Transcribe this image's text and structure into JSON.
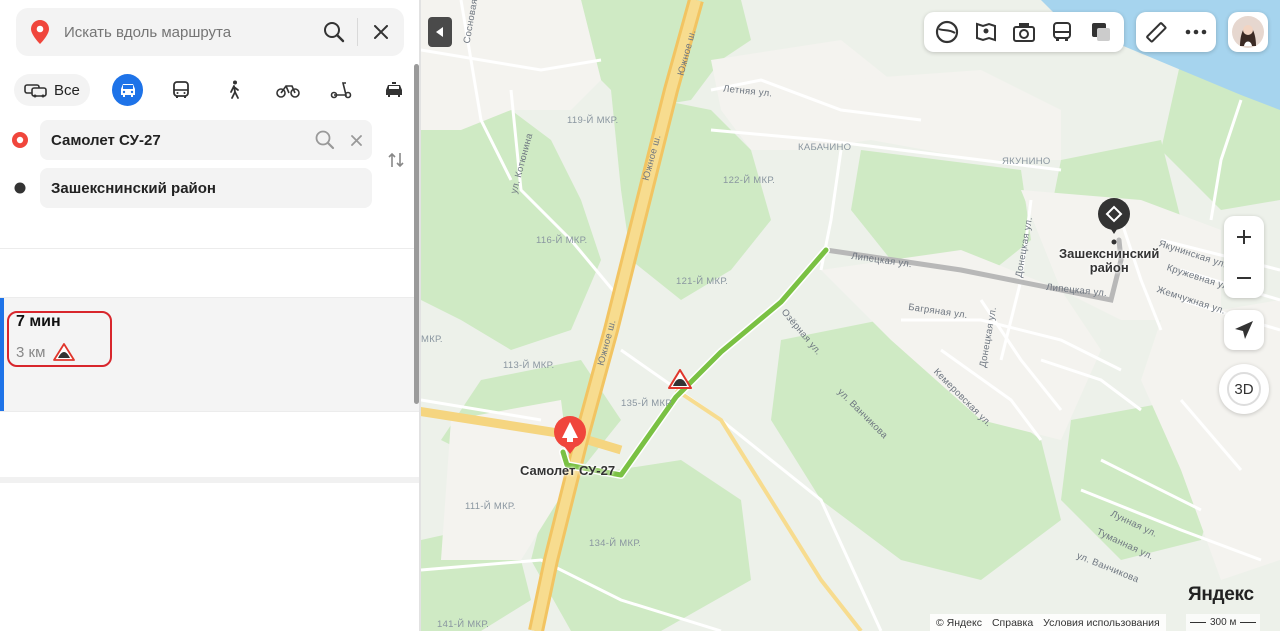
{
  "search": {
    "placeholder": "Искать вдоль маршрута"
  },
  "modes": {
    "all_label": "Все",
    "active": "car"
  },
  "route_points": [
    {
      "label": "Самолет СУ-27",
      "type": "start",
      "color": "#e8432b"
    },
    {
      "label": "Зашекснинский район",
      "type": "end",
      "color": "#333333"
    }
  ],
  "route": {
    "time": "7 мин",
    "distance": "3 км",
    "warning": "uneven-road"
  },
  "map": {
    "streets": {
      "yuzhnoe1": "Южное ш.",
      "yuzhnoe2": "Южное ш.",
      "yuzhnoe3": "Южное ш.",
      "sosnovaya": "Сосновая ул.",
      "kotyunina": "ул. Котюнина",
      "letnyaya": "Летняя ул.",
      "lipetskaya1": "Липецкая ул.",
      "lipetskaya2": "Липецкая ул.",
      "bagryanaya": "Багряная ул.",
      "ozernaya": "Озёрная ул.",
      "vanchikova1": "ул. Ванчикова",
      "vanchikova2": "ул. Ванчикова",
      "kemerovskaya": "Кемеровская ул.",
      "donetskaya1": "Донецкая ул.",
      "donetskaya2": "Донецкая ул.",
      "yakuninskaya": "Якунинская ул.",
      "kruzhevnaya": "Кружевная ул.",
      "zhemchuzhnaya": "Жемчужная ул.",
      "lunnaya": "Лунная ул.",
      "tumannaya": "Туманная ул."
    },
    "districts": {
      "d119": "119-Й МКР.",
      "d122": "122-Й МКР.",
      "d116": "116-Й МКР.",
      "d121": "121-Й МКР.",
      "d113": "113-Й МКР.",
      "d135": "135-Й МКР.",
      "d111": "111-Й МКР.",
      "d134": "134-Й МКР.",
      "d141": "141-Й МКР.",
      "kabachino": "КАБАЧИНО",
      "yakunino": "ЯКУНИНО",
      "mkr": "МКР."
    },
    "places": {
      "start": "Самолет СУ-27",
      "end_line1": "Зашекснинский",
      "end_line2": "район"
    },
    "logo": "Яндекс",
    "copyright": "© Яндекс",
    "help": "Справка",
    "terms": "Условия использования",
    "scale": "300 м",
    "three_d": "3D",
    "route_color": "#7ac143",
    "water_color": "#a6d4ee"
  }
}
